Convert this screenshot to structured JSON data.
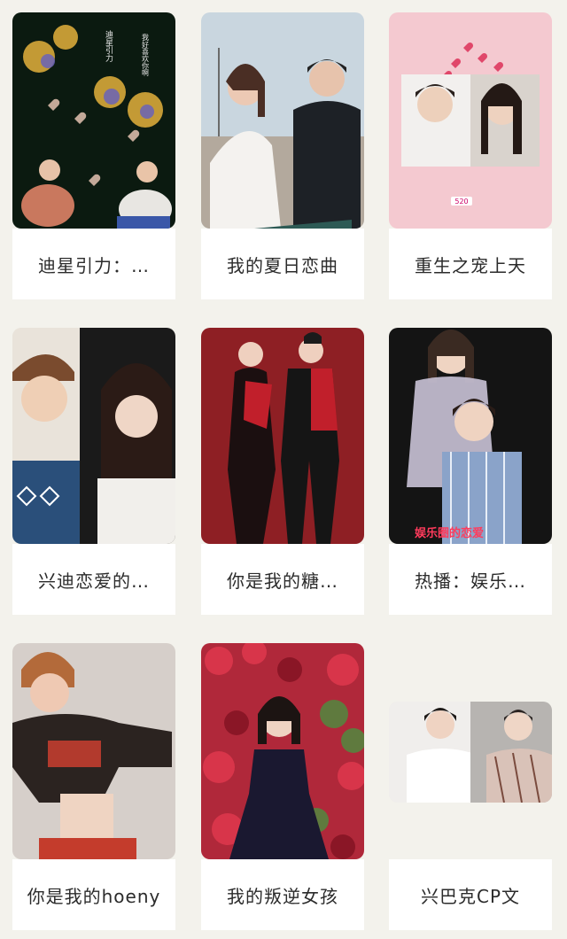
{
  "books": [
    {
      "title": "迪星引力：…",
      "cover": {
        "theme": "dark-flowers-hearts",
        "bg": "#0b1a10",
        "texts": [
          "迪星引力",
          "我好喜欢你啊"
        ]
      }
    },
    {
      "title": "我的夏日恋曲",
      "cover": {
        "theme": "couple-street",
        "bg": "#c9d6df"
      }
    },
    {
      "title": "重生之宠上天",
      "cover": {
        "theme": "pink-split-portrait",
        "bg": "#f4c9d0",
        "texts": [
          "520"
        ]
      }
    },
    {
      "title": "兴迪恋爱的…",
      "cover": {
        "theme": "split-portrait",
        "bg": "#e8e2d8"
      }
    },
    {
      "title": "你是我的糖…",
      "cover": {
        "theme": "red-couple",
        "bg": "#8e1f24"
      }
    },
    {
      "title": "热播：娱乐…",
      "cover": {
        "theme": "dark-couple",
        "bg": "#141414",
        "texts": [
          "娱乐圈的恋爱"
        ]
      }
    },
    {
      "title": "你是我的hoeny",
      "cover": {
        "theme": "portrait-man",
        "bg": "#d6cfca"
      }
    },
    {
      "title": "我的叛逆女孩",
      "cover": {
        "theme": "red-leaves",
        "bg": "#b0283a"
      }
    },
    {
      "title": "兴巴克CP文",
      "cover": {
        "theme": "small-split",
        "bg": "#e9e6e3"
      }
    }
  ]
}
